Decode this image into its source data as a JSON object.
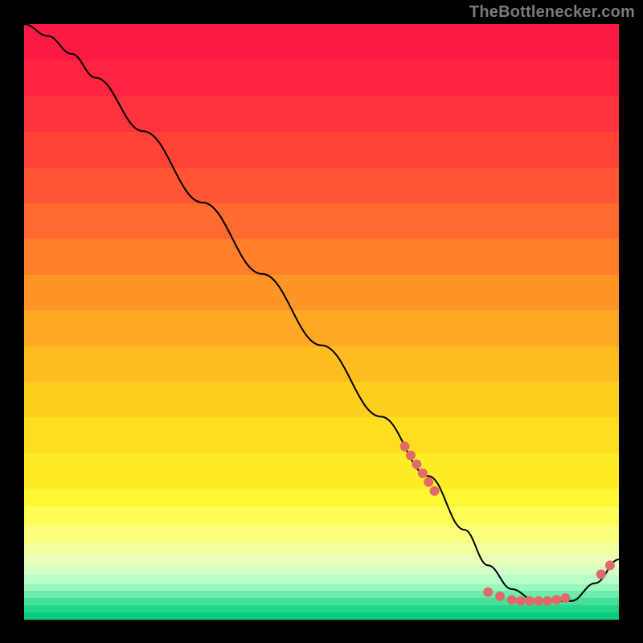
{
  "attribution": "TheBottlenecker.com",
  "colors": {
    "dot": "#e06a6a",
    "line": "#000000",
    "background": "#000000"
  },
  "gradient_bands": [
    {
      "top": 0.0,
      "height": 0.06,
      "color": "#ff1a44"
    },
    {
      "top": 0.06,
      "height": 0.06,
      "color": "#ff2540"
    },
    {
      "top": 0.12,
      "height": 0.06,
      "color": "#ff333b"
    },
    {
      "top": 0.18,
      "height": 0.06,
      "color": "#ff4437"
    },
    {
      "top": 0.24,
      "height": 0.06,
      "color": "#ff5733"
    },
    {
      "top": 0.3,
      "height": 0.06,
      "color": "#ff6b2f"
    },
    {
      "top": 0.36,
      "height": 0.06,
      "color": "#ff7f2b"
    },
    {
      "top": 0.42,
      "height": 0.06,
      "color": "#ff9427"
    },
    {
      "top": 0.48,
      "height": 0.06,
      "color": "#ffa823"
    },
    {
      "top": 0.54,
      "height": 0.06,
      "color": "#ffbc20"
    },
    {
      "top": 0.6,
      "height": 0.06,
      "color": "#ffce1e"
    },
    {
      "top": 0.66,
      "height": 0.06,
      "color": "#ffde1f"
    },
    {
      "top": 0.72,
      "height": 0.06,
      "color": "#ffec25"
    },
    {
      "top": 0.78,
      "height": 0.03,
      "color": "#fff636"
    },
    {
      "top": 0.81,
      "height": 0.03,
      "color": "#fffc55"
    },
    {
      "top": 0.84,
      "height": 0.03,
      "color": "#fcff7a"
    },
    {
      "top": 0.87,
      "height": 0.02,
      "color": "#f4ff9d"
    },
    {
      "top": 0.89,
      "height": 0.02,
      "color": "#e7ffb8"
    },
    {
      "top": 0.91,
      "height": 0.015,
      "color": "#d4ffc8"
    },
    {
      "top": 0.925,
      "height": 0.015,
      "color": "#b8ffc8"
    },
    {
      "top": 0.94,
      "height": 0.012,
      "color": "#96f8bc"
    },
    {
      "top": 0.952,
      "height": 0.012,
      "color": "#6febab"
    },
    {
      "top": 0.964,
      "height": 0.012,
      "color": "#47e09a"
    },
    {
      "top": 0.976,
      "height": 0.012,
      "color": "#24d68c"
    },
    {
      "top": 0.988,
      "height": 0.012,
      "color": "#0acd80"
    }
  ],
  "chart_data": {
    "type": "line",
    "title": "",
    "xlabel": "",
    "ylabel": "",
    "xlim": [
      0,
      100
    ],
    "ylim": [
      0,
      100
    ],
    "legend": false,
    "series": [
      {
        "name": "curve",
        "x": [
          0,
          4,
          8,
          12,
          20,
          30,
          40,
          50,
          60,
          68,
          74,
          78,
          82,
          86,
          92,
          96,
          100
        ],
        "y": [
          100,
          98,
          95,
          91,
          82,
          70,
          58,
          46,
          34,
          24,
          15,
          9,
          5,
          3,
          3,
          6,
          10
        ]
      }
    ],
    "dot_clusters": [
      {
        "name": "cluster-descent",
        "points": [
          {
            "x": 64,
            "y": 29
          },
          {
            "x": 65,
            "y": 27.5
          },
          {
            "x": 66,
            "y": 26
          },
          {
            "x": 67,
            "y": 24.5
          },
          {
            "x": 68,
            "y": 23
          },
          {
            "x": 69,
            "y": 21.5
          }
        ]
      },
      {
        "name": "cluster-valley",
        "points": [
          {
            "x": 78,
            "y": 4.5
          },
          {
            "x": 80,
            "y": 3.8
          },
          {
            "x": 82,
            "y": 3.2
          },
          {
            "x": 83.5,
            "y": 3.0
          },
          {
            "x": 85,
            "y": 3.0
          },
          {
            "x": 86.5,
            "y": 3.0
          },
          {
            "x": 88,
            "y": 3.0
          },
          {
            "x": 89.5,
            "y": 3.2
          },
          {
            "x": 91,
            "y": 3.5
          }
        ]
      },
      {
        "name": "cluster-rise",
        "points": [
          {
            "x": 97,
            "y": 7.5
          },
          {
            "x": 98.5,
            "y": 9
          }
        ]
      }
    ]
  }
}
